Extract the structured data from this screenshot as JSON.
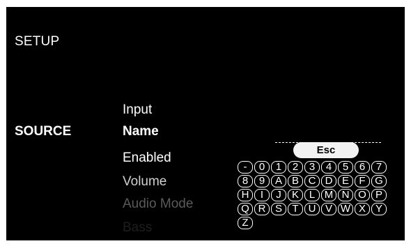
{
  "screen": {
    "title": "SETUP",
    "section_label": "SOURCE"
  },
  "menu": {
    "items": [
      {
        "label": "Input",
        "color": "#ffffff"
      },
      {
        "label": "Name",
        "color": "#ffffff",
        "selected": true
      },
      {
        "label": "Enabled",
        "color": "#ffffff"
      },
      {
        "label": "Volume",
        "color": "#d0d0d0"
      },
      {
        "label": "Audio Mode",
        "color": "#5a5a5a"
      },
      {
        "label": "Bass",
        "color": "#1e1e1e"
      }
    ]
  },
  "name_editor": {
    "value": "",
    "esc_label": "Esc"
  },
  "keyboard": {
    "rows": [
      [
        "-",
        "0",
        "1",
        "2",
        "3",
        "4",
        "5",
        "6",
        "7"
      ],
      [
        "8",
        "9",
        "A",
        "B",
        "C",
        "D",
        "E",
        "F",
        "G"
      ],
      [
        "H",
        "I",
        "J",
        "K",
        "L",
        "M",
        "N",
        "O",
        "P"
      ],
      [
        "Q",
        "R",
        "S",
        "T",
        "U",
        "V",
        "W",
        "X",
        "Y"
      ],
      [
        "Z"
      ]
    ]
  }
}
